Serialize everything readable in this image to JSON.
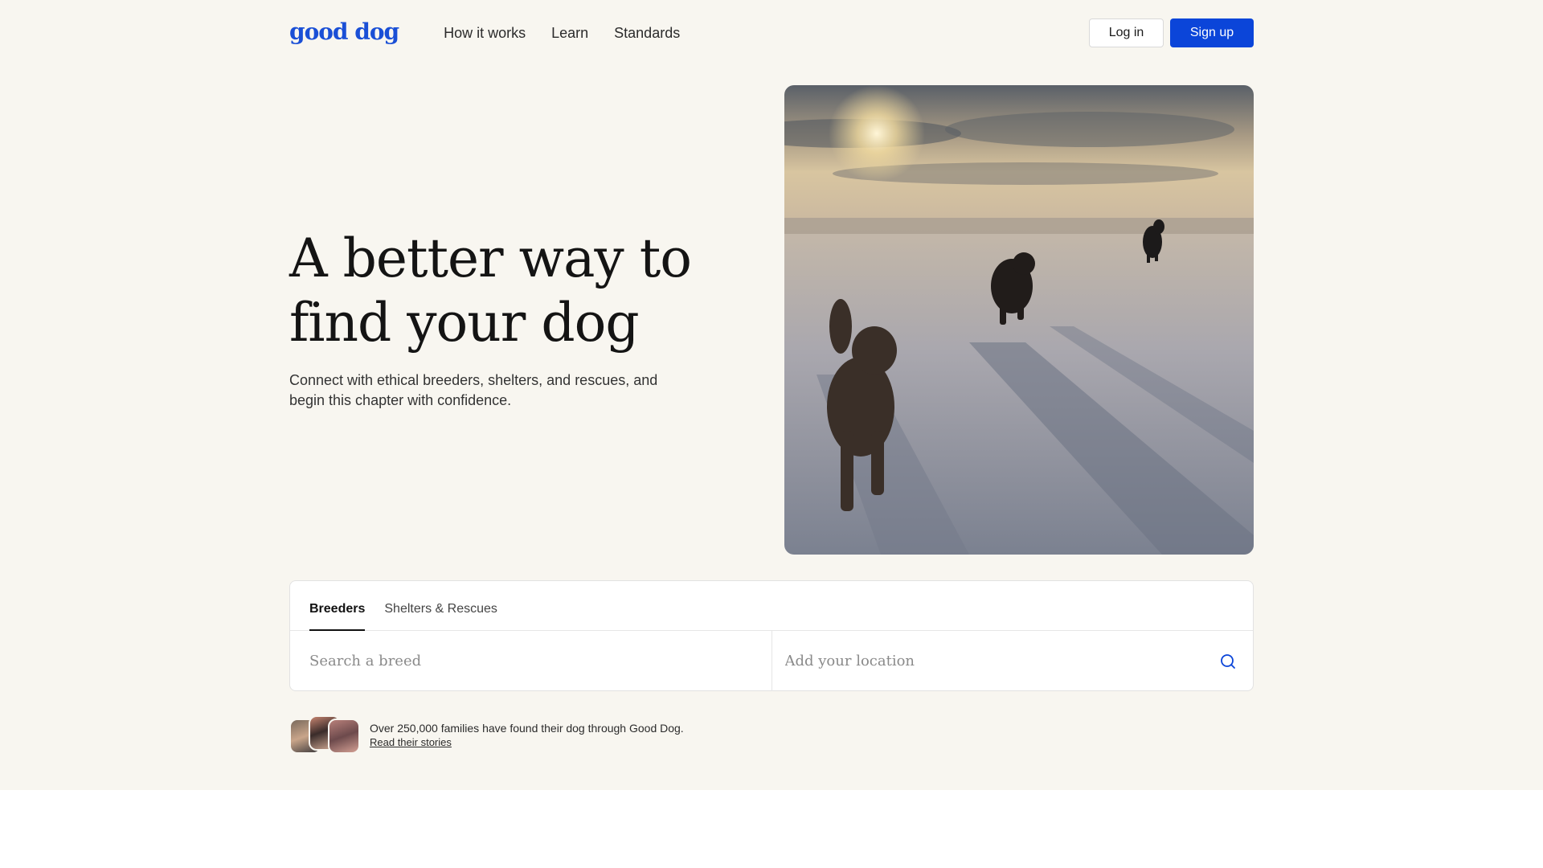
{
  "brand": {
    "logo_text": "good dog",
    "accent_color": "#0b45d9",
    "logo_color": "#1a4fd6"
  },
  "nav": {
    "items": [
      {
        "label": "How it works"
      },
      {
        "label": "Learn"
      },
      {
        "label": "Standards"
      }
    ]
  },
  "header": {
    "login_label": "Log in",
    "signup_label": "Sign up"
  },
  "hero": {
    "headline_line1": "A better way to",
    "headline_line2": "find your dog",
    "subtitle": "Connect with ethical breeders, shelters, and rescues, and begin this chapter with confidence.",
    "image_alt": "Dogs running across a snowy field at sunset"
  },
  "search": {
    "tabs": [
      {
        "label": "Breeders",
        "active": true
      },
      {
        "label": "Shelters & Rescues",
        "active": false
      }
    ],
    "breed_placeholder": "Search a breed",
    "location_placeholder": "Add your location",
    "search_icon": "search-icon"
  },
  "social_proof": {
    "text": "Over 250,000 families have found their dog through Good Dog.",
    "link_label": "Read their stories"
  }
}
